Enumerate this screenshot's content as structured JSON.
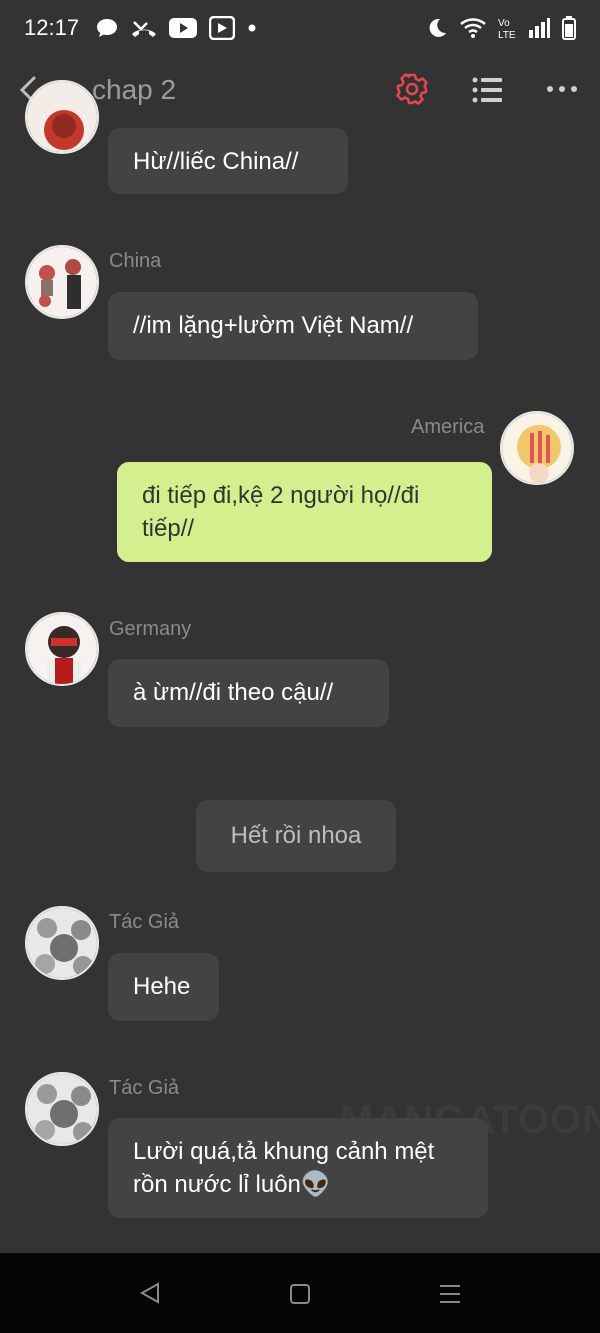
{
  "status_bar": {
    "time": "12:17",
    "left_icons": [
      "chat-bubble-icon",
      "missed-call-icon",
      "youtube-icon",
      "play-box-icon",
      "dot-icon"
    ],
    "right_icons": [
      "moon-icon",
      "wifi-icon",
      "volte-icon",
      "signal-icon",
      "battery-icon"
    ]
  },
  "header": {
    "title": "chap 2",
    "accent_color": "#e8474f"
  },
  "messages": [
    {
      "speaker": "",
      "text": "Hừ//liếc China//",
      "side": "left"
    },
    {
      "speaker": "China",
      "text": "//im lặng+lườm Việt Nam//",
      "side": "left"
    },
    {
      "speaker": "America",
      "text": "đi tiếp đi,kệ 2 người họ//đi tiếp//",
      "side": "right"
    },
    {
      "speaker": "Germany",
      "text": "à ừm//đi theo cậu//",
      "side": "left"
    },
    {
      "narration": "Hết rồi nhoa"
    },
    {
      "speaker": "Tác Giả",
      "text": "Hehe",
      "side": "left"
    },
    {
      "speaker": "Tác Giả",
      "text": "Lười quá,tả khung cảnh mệt rồn nước lỉ luôn👽",
      "side": "left"
    }
  ],
  "watermark": "MANGATOON",
  "colors": {
    "background": "#333333",
    "bubble": "#434343",
    "my_bubble": "#d4f08e"
  }
}
